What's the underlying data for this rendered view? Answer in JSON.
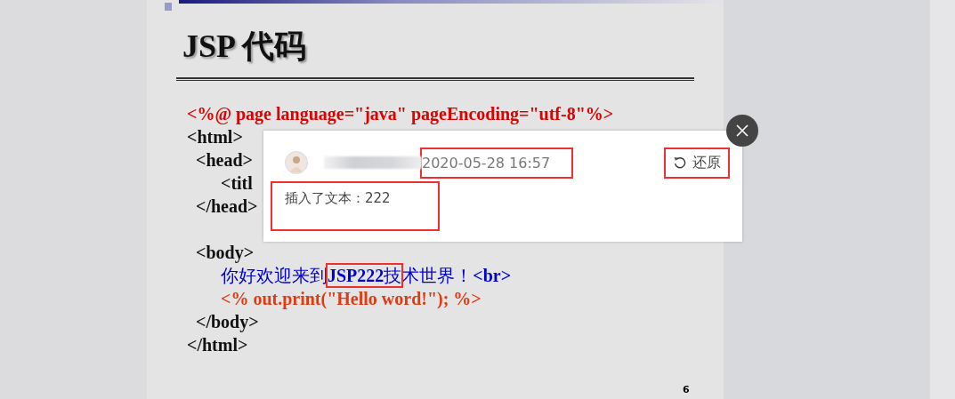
{
  "slide": {
    "title": "JSP 代码",
    "page_number": "6",
    "code_lines": [
      {
        "space_before": false,
        "parts": [
          {
            "text": "<%@ page language=\"java\" pageEncoding=\"utf-8\"%>",
            "color": "#e00000",
            "bold": true,
            "boxed": false
          }
        ]
      },
      {
        "space_before": false,
        "parts": [
          {
            "text": "<html>",
            "color": "#111111",
            "bold": true,
            "boxed": false
          }
        ],
        "children": [
          {
            "space_before": false,
            "parts": [
              {
                "text": "<head>",
                "color": "#111111",
                "bold": true,
                "boxed": false
              }
            ],
            "children": [
              {
                "space_before": false,
                "parts": [
                  {
                    "text": "<titl",
                    "color": "#111111",
                    "bold": true,
                    "boxed": false
                  }
                ]
              }
            ]
          },
          {
            "space_before": false,
            "parts": [
              {
                "text": "</head>",
                "color": "#111111",
                "bold": true,
                "boxed": false
              }
            ]
          },
          {
            "space_before": true,
            "parts": [
              {
                "text": "<body>",
                "color": "#111111",
                "bold": true,
                "boxed": false
              }
            ],
            "children": [
              {
                "space_before": false,
                "parts": [
                  {
                    "text": "你好欢迎来到",
                    "color": "#0000cc",
                    "bold": false,
                    "boxed": false
                  },
                  {
                    "text": "**JSP222**技",
                    "color": "#0000cc",
                    "bold": false,
                    "boxed": true
                  },
                  {
                    "text": "术世界！",
                    "color": "#0000cc",
                    "bold": false,
                    "boxed": false
                  },
                  {
                    "text": "<br>",
                    "color": "#0000cc",
                    "bold": true,
                    "boxed": false
                  }
                ]
              },
              {
                "space_before": false,
                "parts": [
                  {
                    "text": "<% out.print(\"Hello word!\"); %>",
                    "color": "#e03a10",
                    "bold": true,
                    "boxed": false
                  }
                ]
              }
            ]
          },
          {
            "space_before": false,
            "parts": [
              {
                "text": "</body>",
                "color": "#111111",
                "bold": true,
                "boxed": false
              }
            ]
          }
        ]
      },
      {
        "space_before": false,
        "parts": [
          {
            "text": "</html>",
            "color": "#111111",
            "bold": true,
            "boxed": false
          }
        ]
      }
    ]
  },
  "popup": {
    "timestamp": "2020-05-28 16:57",
    "restore_button": "还原",
    "change_text": "插入了文本：222",
    "timestamp_boxed": true,
    "restore_boxed": true,
    "change_boxed": true
  }
}
